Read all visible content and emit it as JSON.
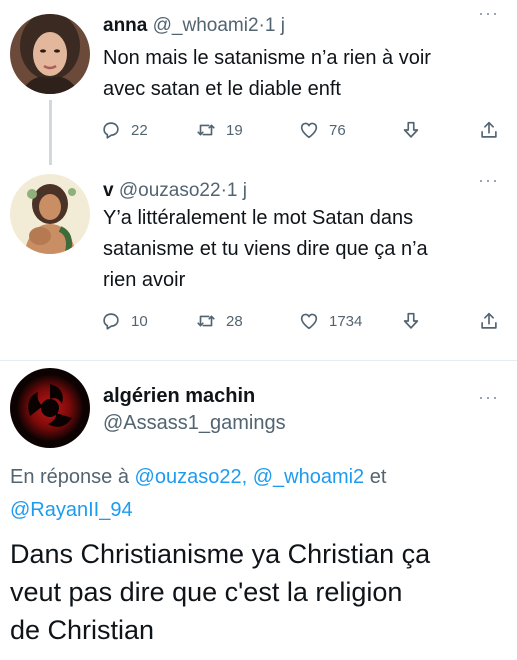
{
  "tweets": [
    {
      "name": "anna",
      "handle": "@_whoami2",
      "dot": "·",
      "time": "1 j",
      "text_lines": [
        "Non mais le satanisme n’a rien à voir",
        "avec satan et le diable enft"
      ],
      "replies": "22",
      "retweets": "19",
      "likes": "76"
    },
    {
      "name": "v",
      "handle": "@ouzaso22",
      "dot": "·",
      "time": "1 j",
      "text_lines": [
        "Y’a littéralement le mot Satan dans",
        "satanisme et tu viens dire que ça n’a",
        "rien avoir"
      ],
      "replies": "10",
      "retweets": "28",
      "likes": "1734"
    }
  ],
  "main_tweet": {
    "name": "algérien machin",
    "handle": "@Assass1_gamings",
    "reply_prefix": "En réponse à",
    "mention_1": "@ouzaso22,",
    "mention_2": "@_whoami2",
    "reply_and": "et",
    "mention_3": "@RayanII_94",
    "text_lines": [
      "Dans Christianisme ya Christian ça",
      "veut pas dire que c'est la religion",
      "de Christian"
    ]
  },
  "more_label": "···",
  "icons": {
    "reply": "reply-icon",
    "retweet": "retweet-icon",
    "like": "heart-icon",
    "bookmark": "bookmark-icon",
    "share": "share-icon",
    "more": "more-icon"
  },
  "colors": {
    "text": "#0f1419",
    "secondary": "#536471",
    "link": "#1d9bf0",
    "thread_line": "#cfd9de"
  }
}
